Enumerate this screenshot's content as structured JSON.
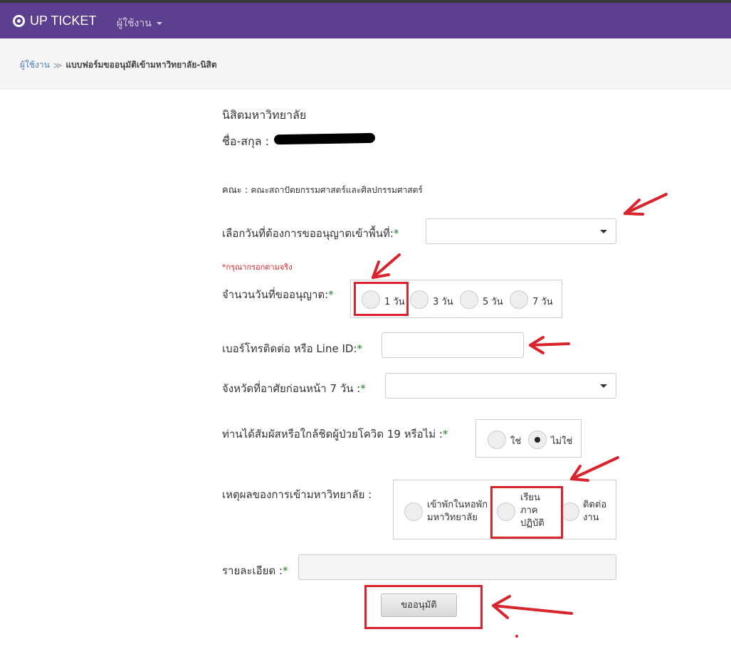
{
  "navbar": {
    "brand": "UP TICKET",
    "user_menu": "ผู้ใช้งาน",
    "brand_color": "#5c3f8e"
  },
  "breadcrumb": {
    "home": "ผู้ใช้งาน",
    "separator": "≫",
    "current": "แบบฟอร์มขออนุมัติเข้ามหาวิทยาลัย-นิสิต"
  },
  "form": {
    "heading": "นิสิตมหาวิทยาลัย",
    "name_label": "ชื่อ-สกุล :",
    "faculty_label": "คณะ :",
    "faculty_value": "คณะสถาปัตยกรรมศาสตร์และศิลปกรรมศาสตร์",
    "date_label": "เลือกวันที่ต้องการขออนุญาตเข้าพื้นที่:",
    "date_value": "",
    "note": "*กรุณากรอกตามจริง",
    "days_label": "จำนวนวันที่ขออนุญาต:",
    "days_options": [
      "1 วัน",
      "3 วัน",
      "5 วัน",
      "7 วัน"
    ],
    "phone_label": "เบอร์โทรติดต่อ หรือ Line ID:",
    "phone_value": "",
    "province_label": "จังหวัดที่อาศัยก่อนหน้า 7 วัน :",
    "province_value": "",
    "covid_label": "ท่านได้สัมผัสหรือใกล้ชิดผู้ป่วยโควิด 19 หรือไม่ :",
    "covid_options": [
      "ใช่",
      "ไม่ใช่"
    ],
    "covid_selected": "ไม่ใช่",
    "reason_label": "เหตุผลของการเข้ามหาวิทยาลัย :",
    "reason_options": [
      {
        "line1": "เข้าพักในหอพัก",
        "line2": "มหาวิทยาลัย"
      },
      {
        "line1": "เรียน",
        "line2": "ภาค",
        "line3": "ปฏิบัติ"
      },
      {
        "line1": "ติดต่อ",
        "line2": "งาน"
      }
    ],
    "detail_label": "รายละเอียด :",
    "detail_value": "",
    "required_mark": "*",
    "submit": "ขออนุมัติ"
  },
  "annotation_color": "#d9232d"
}
